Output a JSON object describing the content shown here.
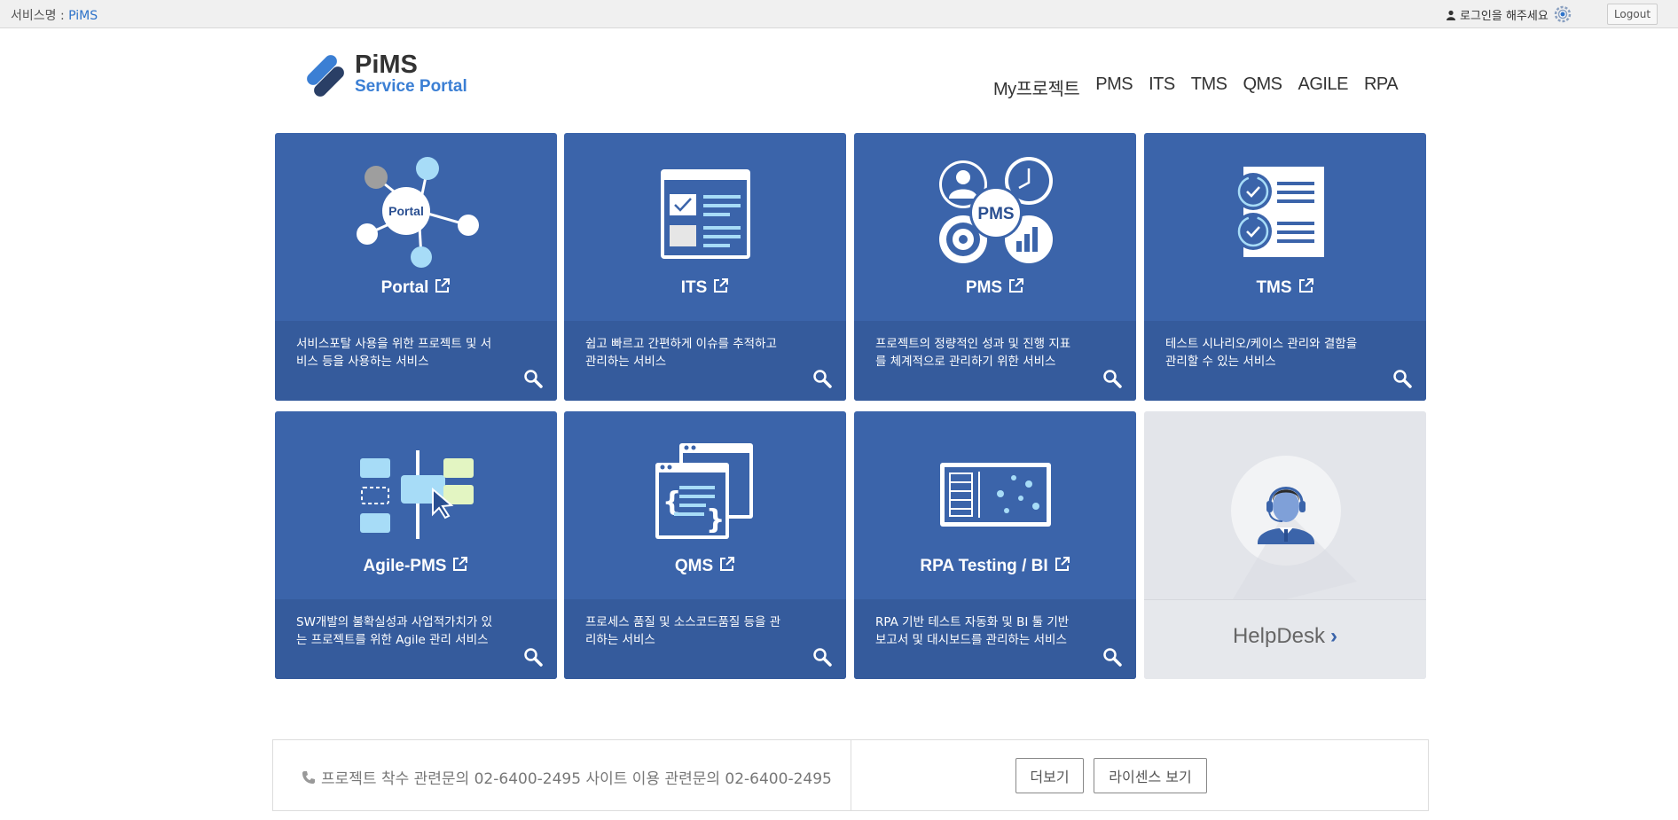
{
  "topbar": {
    "service_label": "서비스명 : ",
    "service_name": "PiMS",
    "login_text": "로그인을 해주세요",
    "logout": "Logout"
  },
  "logo": {
    "line1": "PiMS",
    "line2": "Service Portal"
  },
  "nav": [
    "My프로젝트",
    "PMS",
    "ITS",
    "TMS",
    "QMS",
    "AGILE",
    "RPA"
  ],
  "tiles": [
    {
      "title": "Portal",
      "desc": "서비스포탈 사용을 위한 프로젝트 및 서비스 등을 사용하는 서비스",
      "art_text": "Portal"
    },
    {
      "title": "ITS",
      "desc": "쉽고 빠르고 간편하게 이슈를 추적하고 관리하는 서비스"
    },
    {
      "title": "PMS",
      "desc": "프로젝트의 정량적인 성과 및 진행 지표를 체계적으로 관리하기 위한 서비스",
      "art_text": "PMS"
    },
    {
      "title": "TMS",
      "desc": "테스트 시나리오/케이스 관리와 결함을 관리할 수 있는 서비스"
    },
    {
      "title": "Agile-PMS",
      "desc": "SW개발의 불확실성과 사업적가치가 있는 프로젝트를 위한 Agile 관리 서비스"
    },
    {
      "title": "QMS",
      "desc": "프로세스 품질 및 소스코드품질 등을 관리하는 서비스"
    },
    {
      "title": "RPA Testing / BI",
      "desc": "RPA 기반 테스트 자동화 및 BI 툴 기반 보고서 및 대시보드를 관리하는 서비스"
    }
  ],
  "helpdesk": {
    "label": "HelpDesk",
    "chevron": "›"
  },
  "footer": {
    "info": "프로젝트 착수 관련문의 02-6400-2495   사이트 이용 관련문의 02-6400-2495",
    "more": "더보기",
    "license": "라이센스 보기"
  },
  "colors": {
    "tile": "#3b64aa",
    "tile_desc": "#355b9c",
    "accent": "#2d72c9"
  }
}
